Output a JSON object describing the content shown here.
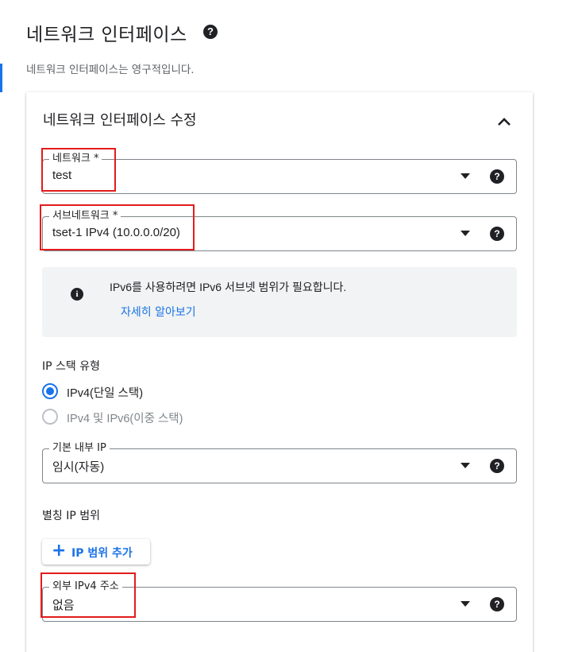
{
  "header": {
    "title": "네트워크 인터페이스",
    "help_icon": "?",
    "description": "네트워크 인터페이스는 영구적입니다."
  },
  "card": {
    "title": "네트워크 인터페이스 수정",
    "collapse_icon": "chevron-up-icon"
  },
  "network": {
    "label": "네트워크 *",
    "value": "test"
  },
  "subnetwork": {
    "label": "서브네트워크 *",
    "value": "tset-1 IPv4 (10.0.0.0/20)"
  },
  "info": {
    "icon": "i",
    "text": "IPv6를 사용하려면 IPv6 서브넷 범위가 필요합니다.",
    "link": "자세히 알아보기"
  },
  "ip_stack": {
    "label": "IP 스택 유형",
    "options": [
      {
        "label": "IPv4(단일 스택)",
        "checked": true,
        "disabled": false
      },
      {
        "label": "IPv4 및 IPv6(이중 스택)",
        "checked": false,
        "disabled": true
      }
    ]
  },
  "primary_ip": {
    "label": "기본 내부 IP",
    "value": "임시(자동)"
  },
  "alias_ip": {
    "label": "별칭 IP 범위",
    "add_button": "IP 범위 추가"
  },
  "external_ip": {
    "label": "외부 IPv4 주소",
    "value": "없음"
  },
  "colors": {
    "accent": "#1a73e8",
    "highlight": "#e31c1c",
    "info_bg": "#f1f3f4"
  }
}
